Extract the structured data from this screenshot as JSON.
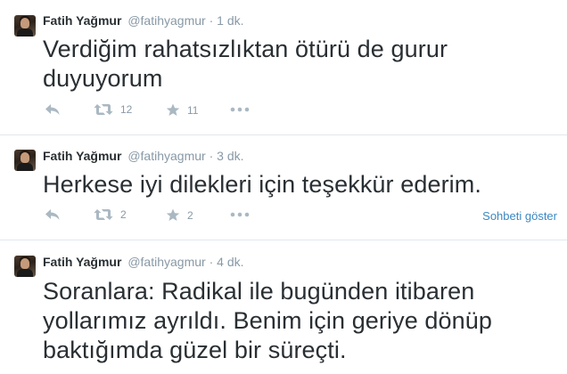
{
  "tweets": [
    {
      "name": "Fatih Yağmur",
      "handle": "@fatihyagmur",
      "separator": "·",
      "time": "1 dk.",
      "text": "Verdiğim rahatsızlıktan ötürü de gurur\nduyuyorum",
      "retweets": "12",
      "favorites": "11"
    },
    {
      "name": "Fatih Yağmur",
      "handle": "@fatihyagmur",
      "separator": "·",
      "time": "3 dk.",
      "text": "Herkese iyi dilekleri için teşekkür ederim.",
      "retweets": "2",
      "favorites": "2",
      "conversation_link": "Sohbeti göster"
    },
    {
      "name": "Fatih Yağmur",
      "handle": "@fatihyagmur",
      "separator": "·",
      "time": "4 dk.",
      "text": "Soranlara: Radikal ile bugünden itibaren\nyollarımız ayrıldı. Benim için geriye dönüp\nbaktığımda güzel bir süreçti."
    }
  ],
  "icons": {
    "reply": "reply-icon",
    "retweet": "retweet-icon",
    "favorite": "star-icon",
    "more": "more-icon"
  },
  "colors": {
    "text": "#292f33",
    "muted": "#8899a6",
    "icon": "#aab8c2",
    "link": "#3b88c3",
    "separator": "#e1e8ed"
  }
}
